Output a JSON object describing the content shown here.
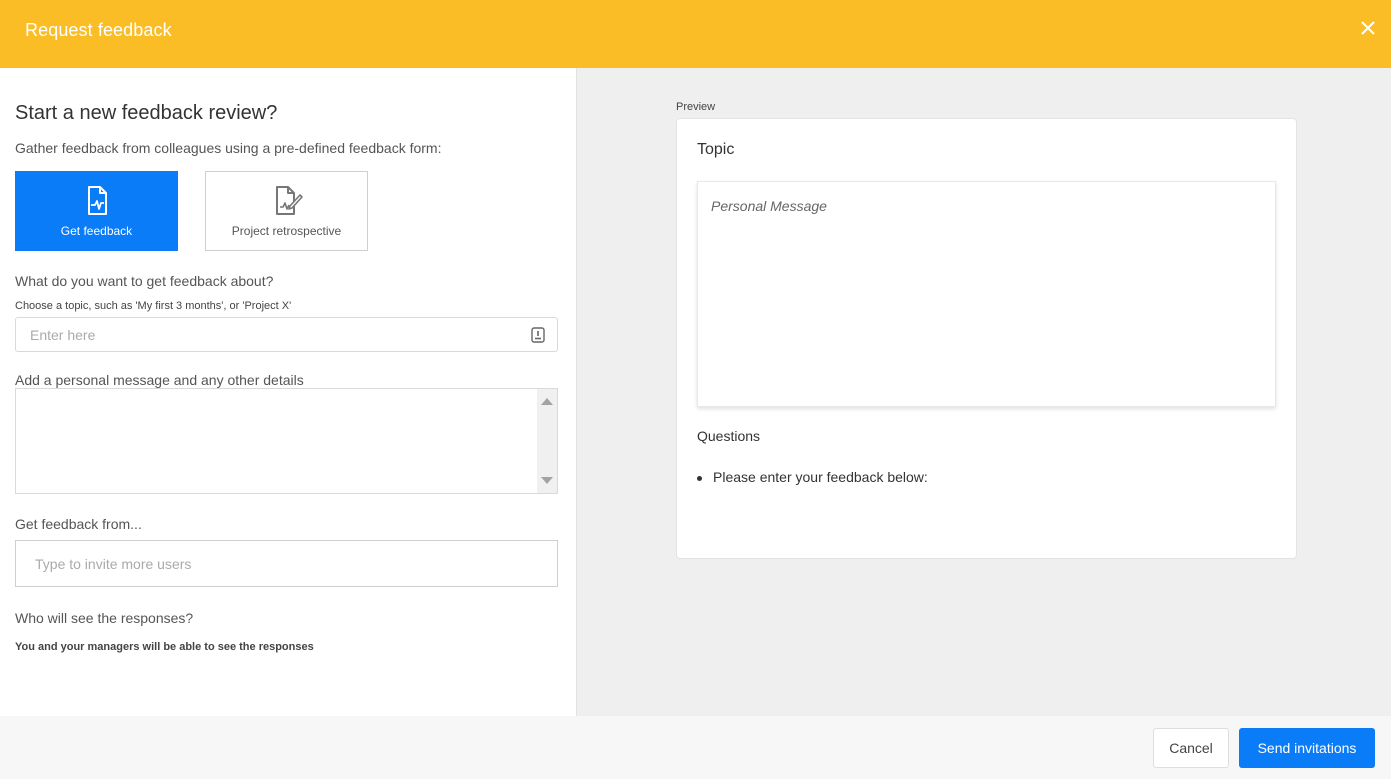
{
  "header": {
    "title": "Request feedback",
    "close_icon": "close-icon",
    "background": "#fbbd26"
  },
  "left": {
    "title": "Start a new feedback review?",
    "subtitle": "Gather feedback from colleagues using a pre-defined feedback form:",
    "forms": [
      {
        "label": "Get feedback",
        "icon": "document-pulse-icon",
        "selected": true
      },
      {
        "label": "Project retrospective",
        "icon": "document-edit-icon",
        "selected": false
      }
    ],
    "topic": {
      "label": "What do you want to get feedback about?",
      "hint": "Choose a topic, such as 'My first 3 months', or 'Project X'",
      "placeholder": "Enter here",
      "value": ""
    },
    "message": {
      "label": "Add a personal message and any other details",
      "value": ""
    },
    "invite": {
      "label": "Get feedback from...",
      "placeholder": "Type to invite more users"
    },
    "visibility": {
      "label": "Who will see the responses?",
      "text": "You and your managers will be able to see the responses"
    }
  },
  "preview": {
    "label": "Preview",
    "topic": "Topic",
    "message_placeholder": "Personal Message",
    "questions_label": "Questions",
    "questions": [
      "Please enter your feedback below:"
    ]
  },
  "footer": {
    "cancel_label": "Cancel",
    "send_label": "Send invitations"
  },
  "colors": {
    "accent": "#0a7cf7",
    "header": "#fbbd26",
    "panel_bg": "#efefef"
  }
}
